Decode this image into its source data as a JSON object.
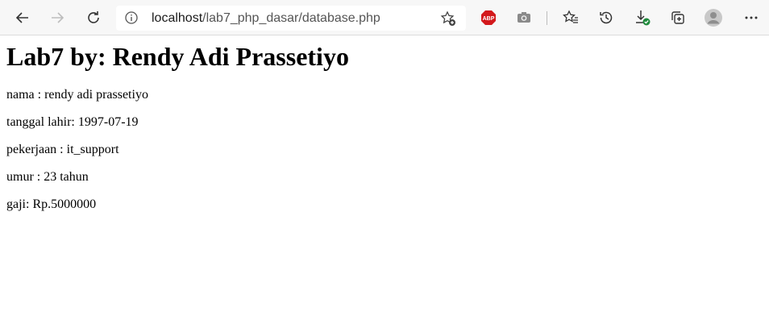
{
  "browser": {
    "url_host": "localhost",
    "url_path": "/lab7_php_dasar/database.php"
  },
  "page": {
    "heading": "Lab7 by: Rendy Adi Prassetiyo",
    "lines": [
      "nama : rendy adi prassetiyo",
      "tanggal lahir: 1997-07-19",
      "pekerjaan : it_support",
      "umur : 23 tahun",
      "gaji: Rp.5000000"
    ]
  },
  "icons": {
    "back": "back-arrow-icon",
    "forward": "forward-arrow-icon",
    "reload": "reload-icon",
    "info": "info-icon",
    "add_favorite": "add-favorite-icon",
    "adblock": "adblock-plus-icon",
    "camera": "camera-icon",
    "favorites": "favorites-icon",
    "history": "history-icon",
    "downloads": "downloads-icon",
    "collections": "collections-icon",
    "profile": "profile-icon",
    "menu": "more-menu-icon"
  },
  "colors": {
    "toolbar_bg": "#f7f7f7",
    "abp_red": "#d3191c",
    "download_badge": "#1f8a3c"
  }
}
